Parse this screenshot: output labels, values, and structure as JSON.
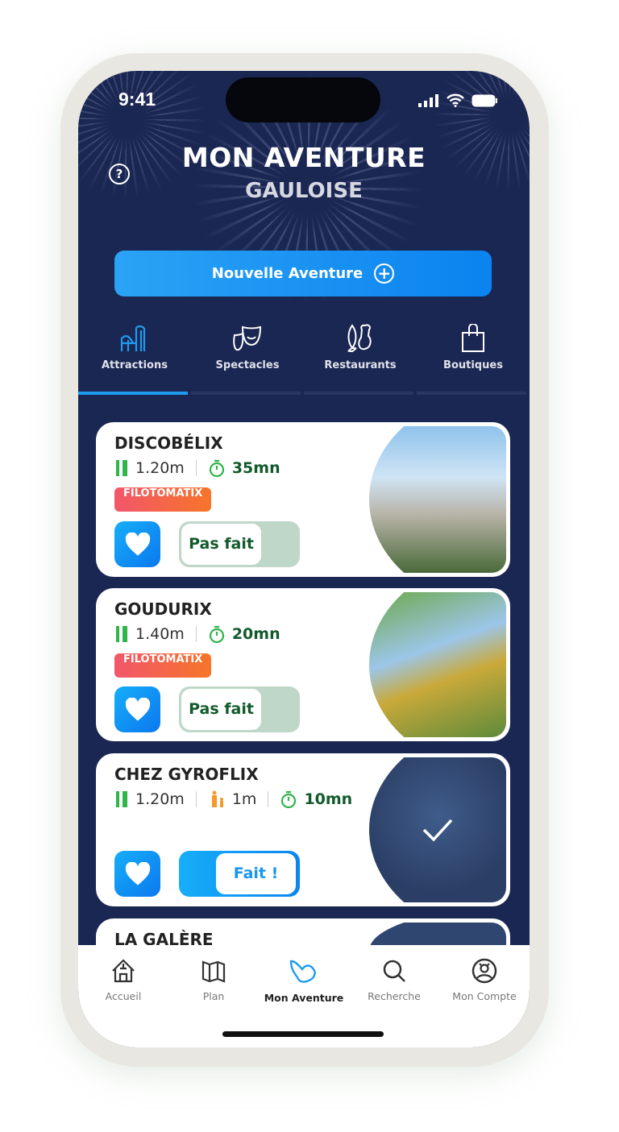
{
  "status_bar": {
    "time": "9:41"
  },
  "header": {
    "title": "MON AVENTURE",
    "subtitle": "GAULOISE",
    "help_icon": "question-circle-icon"
  },
  "new_adventure_button": {
    "label": "Nouvelle Aventure",
    "icon": "plus-circle-icon"
  },
  "category_tabs": [
    {
      "label": "Attractions",
      "icon": "roller-coaster-icon",
      "active": true
    },
    {
      "label": "Spectacles",
      "icon": "theater-masks-icon",
      "active": false
    },
    {
      "label": "Restaurants",
      "icon": "fish-drumstick-icon",
      "active": false
    },
    {
      "label": "Boutiques",
      "icon": "shopping-bag-icon",
      "active": false
    }
  ],
  "attractions": [
    {
      "name": "DISCOBÉLIX",
      "height": "1.20m",
      "duration": "35mn",
      "badge": "FILOTOMATIX",
      "status": "Pas fait",
      "done": false
    },
    {
      "name": "GOUDURIX",
      "height": "1.40m",
      "duration": "20mn",
      "badge": "FILOTOMATIX",
      "status": "Pas fait",
      "done": false
    },
    {
      "name": "CHEZ GYROFLIX",
      "height": "1.20m",
      "accompanied": "1m",
      "duration": "10mn",
      "status": "Fait !",
      "done": true
    },
    {
      "name": "LA GALÈRE"
    }
  ],
  "bottom_nav": [
    {
      "label": "Accueil",
      "icon": "house-icon",
      "active": false
    },
    {
      "label": "Plan",
      "icon": "map-icon",
      "active": false
    },
    {
      "label": "Mon Aventure",
      "icon": "adventure-icon",
      "active": true
    },
    {
      "label": "Recherche",
      "icon": "search-icon",
      "active": false
    },
    {
      "label": "Mon Compte",
      "icon": "account-icon",
      "active": false
    }
  ],
  "colors": {
    "background": "#1b2753",
    "accent": "#1e9bf0",
    "duration_green": "#125a2c",
    "badge": "#f2566a"
  }
}
